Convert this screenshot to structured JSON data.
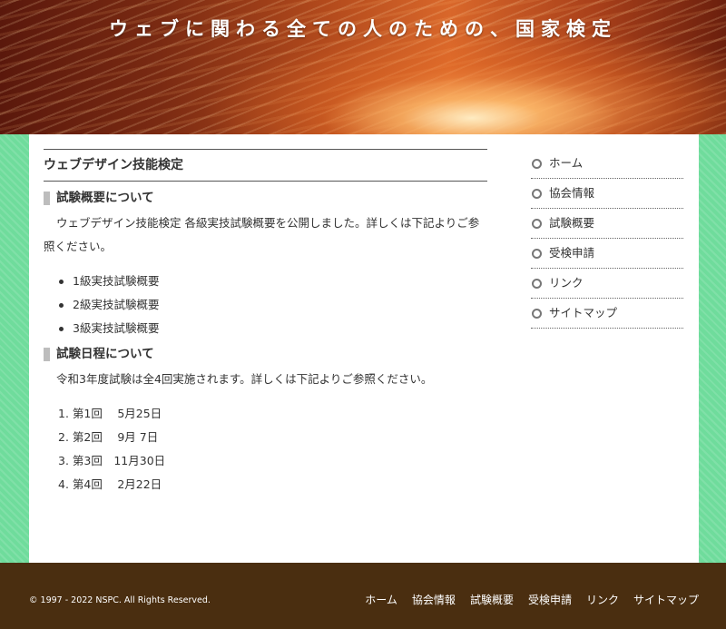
{
  "header": {
    "title": "ウェブに関わる全ての人のための、国家検定"
  },
  "content": {
    "page_title": "ウェブデザイン技能検定",
    "overview": {
      "heading": "試験概要について",
      "text": "ウェブデザイン技能検定 各級実技試験概要を公開しました。詳しくは下記よりご参照ください。",
      "items": [
        "1級実技試験概要",
        "2級実技試験概要",
        "3級実技試験概要"
      ]
    },
    "schedule": {
      "heading": "試験日程について",
      "text": "令和3年度試験は全4回実施されます。詳しくは下記よりご参照ください。",
      "items": [
        "1. 第1回　 5月25日",
        "2. 第2回　 9月 7日",
        "3. 第3回　11月30日",
        "4. 第4回　 2月22日"
      ]
    }
  },
  "sidebar": {
    "items": [
      "ホーム",
      "協会情報",
      "試験概要",
      "受検申請",
      "リンク",
      "サイトマップ"
    ]
  },
  "footer": {
    "copyright": "© 1997 - 2022 NSPC. All Rights Reserved.",
    "nav": [
      "ホーム",
      "協会情報",
      "試験概要",
      "受検申請",
      "リンク",
      "サイトマップ"
    ]
  },
  "colors": {
    "header_accent": "#d9672a",
    "side_background": "#6fdc9c",
    "footer_background": "#4a2e10"
  }
}
